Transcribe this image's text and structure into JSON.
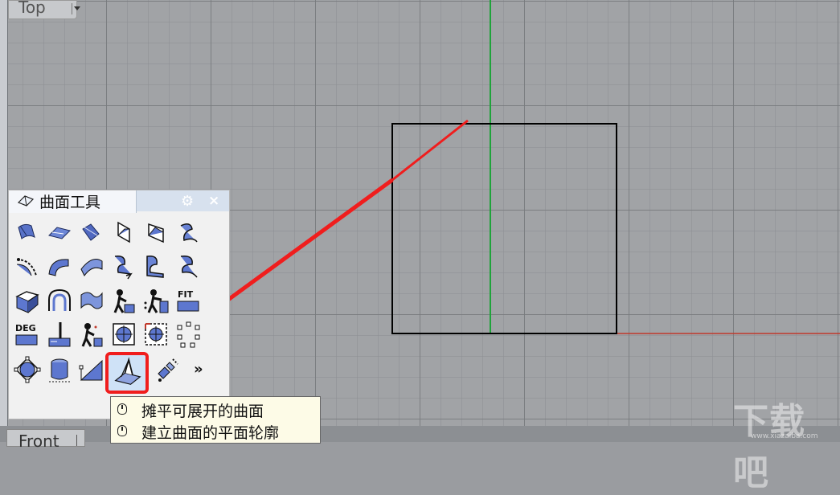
{
  "viewport": {
    "top_title": "Top",
    "front_title": "Front",
    "axis_colors": {
      "y_axis": "#1fa33a",
      "x_axis": "#c0392b"
    },
    "rectangle_color": "#000000",
    "annotation_color": "#f01d1d"
  },
  "panel": {
    "title": "曲面工具",
    "tab_icon": "surface-tools-icon",
    "gear_icon": "gear-icon",
    "close_icon": "close-icon",
    "more_label": "»",
    "tools": [
      "surface-edit-icon",
      "surface-plane-icon",
      "surface-flip-icon",
      "surface-fold-icon",
      "surface-twist-icon",
      "surface-blend-icon",
      "fillet-curve-icon",
      "surface-bend-icon",
      "surface-arc-icon",
      "surface-rebuild-icon",
      "surface-match-icon",
      "surface-extend-icon",
      "surface-shade-icon",
      "surface-arch-icon",
      "surface-wave-icon",
      "surface-person-icon",
      "surface-person2-icon",
      "fit-icon",
      "deg-icon",
      "surface-cut-icon",
      "surface-person3-icon",
      "point-target-icon",
      "point-target-active-icon",
      "dotted-square-icon",
      "control-points-icon",
      "cylinder-icon",
      "triangle-icon",
      "unroll-surface-icon",
      "satellite-icon"
    ],
    "fit_label": "FIT",
    "deg_label": "DEG",
    "selected_tool": "unroll-surface-icon"
  },
  "tooltip": {
    "rows": [
      {
        "icon": "left-mouse-icon",
        "text": "摊平可展开的曲面"
      },
      {
        "icon": "right-mouse-icon",
        "text": "建立曲面的平面轮廓"
      }
    ]
  },
  "watermark": {
    "text": "下载吧",
    "sub": "www.xiazaiba.com"
  }
}
